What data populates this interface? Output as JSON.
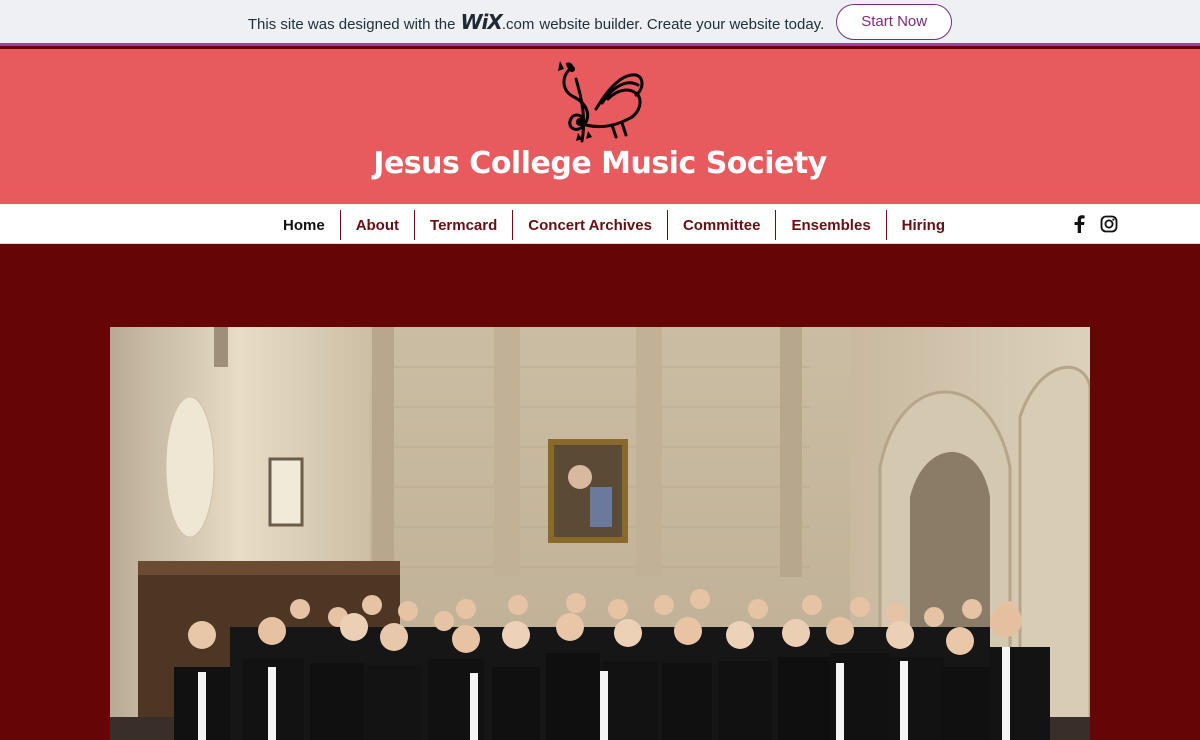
{
  "wix_banner": {
    "text_before": "This site was designed with the",
    "logo_text": "WiX",
    "dotcom": ".com",
    "text_after": "website builder. Create your website today.",
    "cta_label": "Start Now"
  },
  "header": {
    "title": "Jesus College Music Society",
    "logo_icon": "rooster-treble-clef-icon",
    "background": "#e75a5e"
  },
  "nav": {
    "items": [
      {
        "label": "Home"
      },
      {
        "label": "About"
      },
      {
        "label": "Termcard"
      },
      {
        "label": "Concert Archives"
      },
      {
        "label": "Committee"
      },
      {
        "label": "Ensembles"
      },
      {
        "label": "Hiring"
      }
    ],
    "social": [
      "facebook-icon",
      "instagram-icon"
    ]
  },
  "main": {
    "background": "#650506",
    "photo_subject": "group-photo"
  },
  "colors": {
    "accent": "#6b0e12",
    "wix_purple": "#7c2c80"
  }
}
